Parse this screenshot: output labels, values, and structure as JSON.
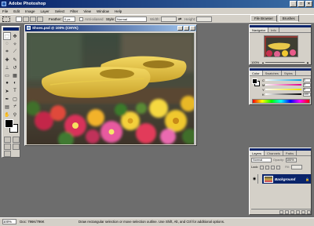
{
  "app": {
    "title": "Adobe Photoshop",
    "window_buttons": [
      "_",
      "□",
      "×"
    ]
  },
  "menu": [
    "File",
    "Edit",
    "Image",
    "Layer",
    "Select",
    "Filter",
    "View",
    "Window",
    "Help"
  ],
  "options_bar": {
    "feather_label": "Feather:",
    "feather_value": "0 px",
    "antialiased_label": "Anti-aliased",
    "style_label": "Style:",
    "style_value": "Normal",
    "width_label": "Width:",
    "height_label": "Height:"
  },
  "dock_tabs": [
    "File Browser",
    "Brushes"
  ],
  "document": {
    "title": "Shoes.psd @ 100% (CMYK)"
  },
  "navigator": {
    "tabs": [
      "Navigator",
      "Info"
    ],
    "zoom": "100%"
  },
  "color_palette": {
    "tabs": [
      "Color",
      "Swatches",
      "Styles"
    ],
    "channels": [
      {
        "label": "C",
        "value": "0",
        "color": "#00a0e0"
      },
      {
        "label": "M",
        "value": "0",
        "color": "#e0008a"
      },
      {
        "label": "Y",
        "value": "0",
        "color": "#f0e000"
      },
      {
        "label": "K",
        "value": "100",
        "color": "#000000"
      }
    ]
  },
  "layers_palette": {
    "tabs": [
      "Layers",
      "Channels",
      "Paths"
    ],
    "mode": "Normal",
    "opacity_label": "Opacity:",
    "opacity_value": "100%",
    "lock_label": "Lock:",
    "fill_label": "Fill:",
    "layer_name": "Background"
  },
  "status": {
    "zoom": "100%",
    "doc_size": "Doc: 796K/796K",
    "hint": "Draw rectangular selection or move selection outline. Use Shift, Alt, and Ctrl for additional options."
  },
  "colors": {
    "accent": "#0a246a",
    "chrome": "#d4d0c8",
    "workspace": "#6d6d6d"
  }
}
